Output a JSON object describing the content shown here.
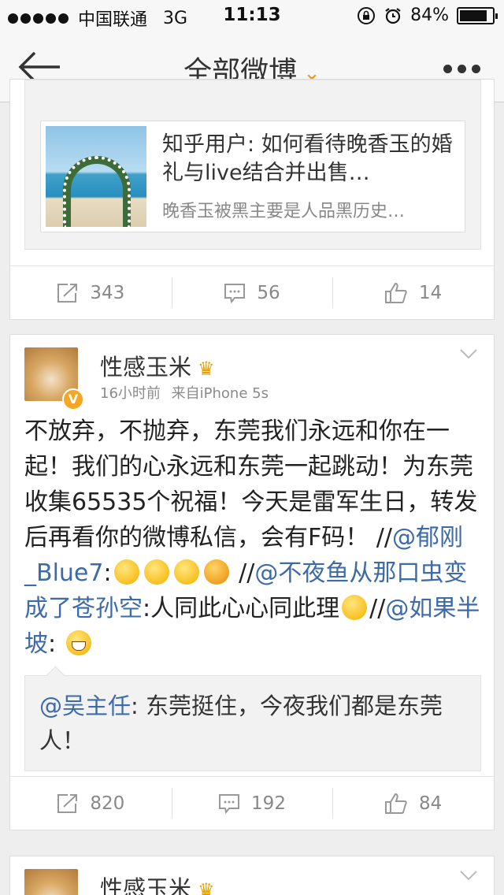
{
  "status_bar": {
    "carrier": "中国联通",
    "network": "3G",
    "time": "11:13",
    "battery": "84%",
    "battery_level": 0.84
  },
  "nav": {
    "title": "全部微博",
    "accent_color": "#f39a1e"
  },
  "posts": [
    {
      "link_card": {
        "title": "知乎用户: 如何看待晚香玉的婚礼与live结合并出售…",
        "description": "晚香玉被黑主要是人品黑历史…"
      },
      "actions": {
        "repost": "343",
        "comment": "56",
        "like": "14"
      }
    },
    {
      "author": "性感玉米",
      "verified_badge": "V",
      "time": "16小时前",
      "source": "来自iPhone 5s",
      "text": {
        "t1": "不放弃，不抛弃，东莞我们永远和你在一起！我们的心永远和东莞一起跳动！为东莞收集65535个祝福！今天是雷军生日，转发后再看你的微博私信，会有F码！ //",
        "m1": "@郁刚_Blue7",
        "t2": ":",
        "t3": " //",
        "m2": "@不夜鱼从那口虫变成了苍孙空",
        "t4": ":人同此心心同此理",
        "t5": "//",
        "m3": "@如果半坡",
        "t6": ": "
      },
      "repost": {
        "mention": "@吴主任",
        "text": ": 东莞挺住，今夜我们都是东莞人！"
      },
      "actions": {
        "repost": "820",
        "comment": "192",
        "like": "84"
      }
    },
    {
      "author": "性感玉米"
    }
  ]
}
